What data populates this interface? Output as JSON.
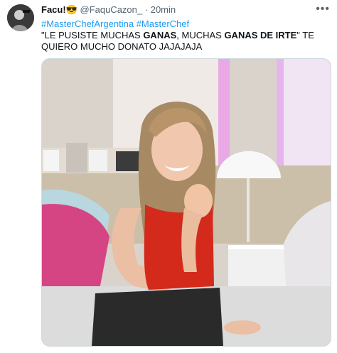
{
  "tweet": {
    "display_name": "Facu!",
    "emoji": "😎",
    "handle": "@FaquCazon_",
    "separator": "·",
    "time": "20min",
    "hashtags": [
      "#MasterChefArgentina",
      "#MasterChef"
    ],
    "text_parts": [
      {
        "t": "\"LE PUSISTE MUCHAS ",
        "b": false
      },
      {
        "t": "GANAS",
        "b": true
      },
      {
        "t": ", MUCHAS ",
        "b": false
      },
      {
        "t": "GANAS DE IRTE",
        "b": true
      },
      {
        "t": "\" TE QUIERO MUCHO DONATO JAJAJAJA",
        "b": false
      }
    ],
    "more_icon": "more-horizontal-icon",
    "media_alt": "photo"
  },
  "colors": {
    "hashtag": "#1d9bf0",
    "meta": "#536471",
    "top_red": "#d42a1c"
  }
}
